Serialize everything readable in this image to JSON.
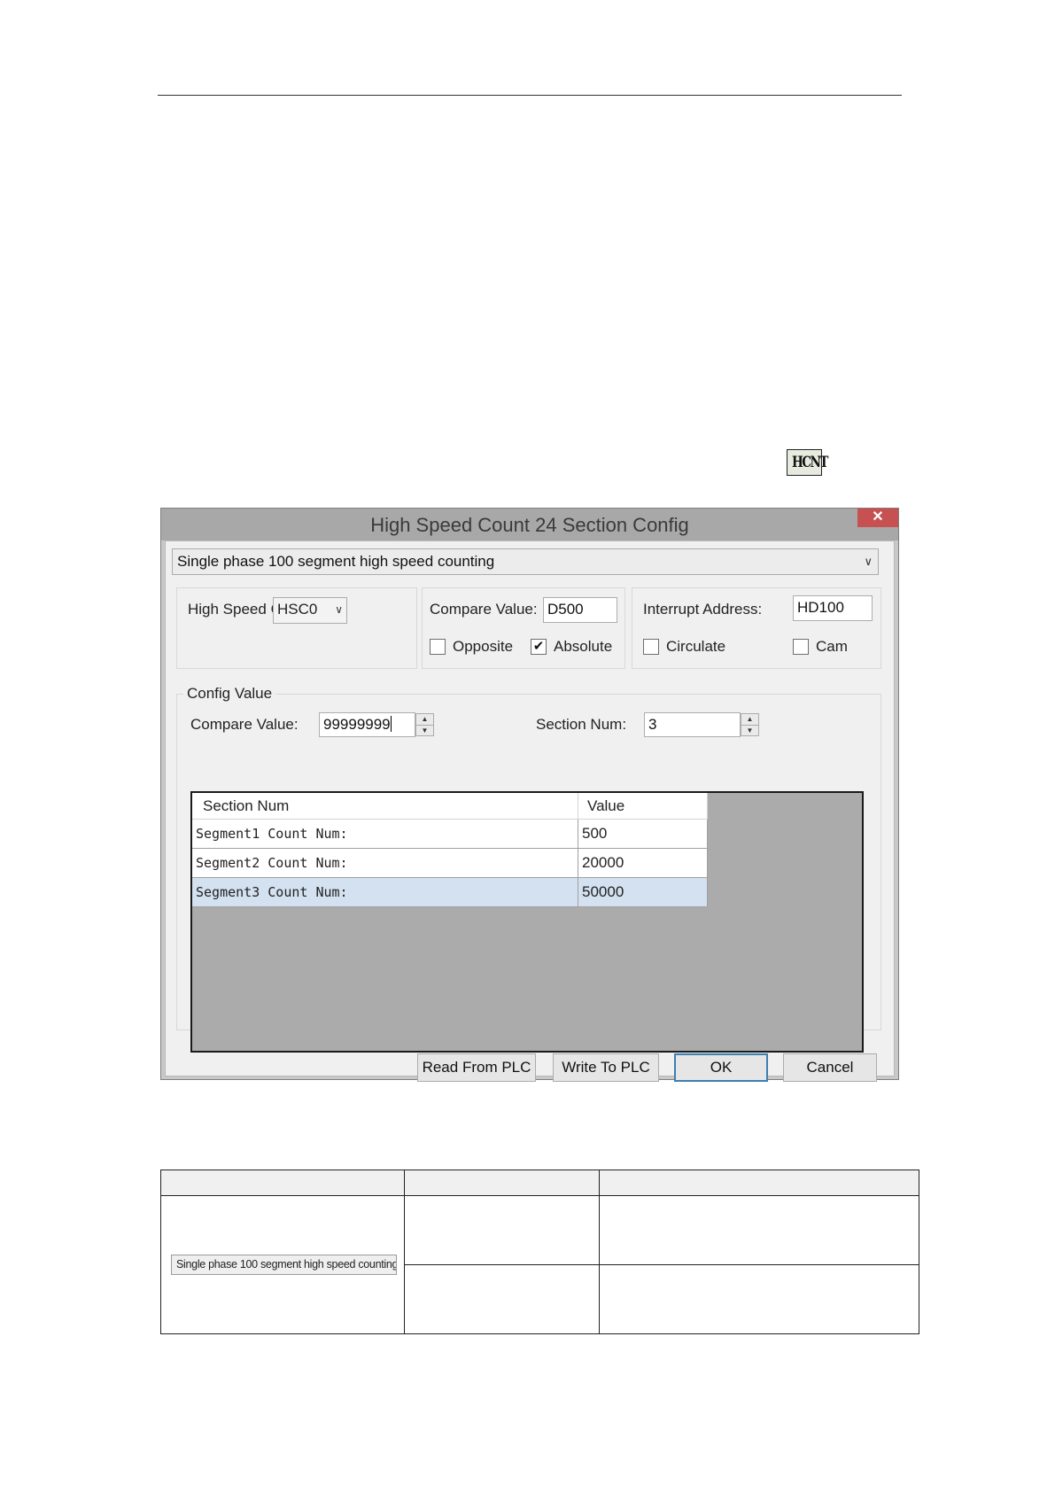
{
  "toolbar_icon": {
    "label": "HCNT",
    "name": "hcnt-icon"
  },
  "dialog": {
    "title": "High Speed Count 24 Section Config",
    "close_glyph": "✕",
    "mode_select": {
      "value": "Single phase 100 segment high speed counting"
    },
    "high_speed_counter": {
      "label": "High Speed C",
      "value": "HSC0"
    },
    "compare": {
      "label": "Compare Value:",
      "value": "D500",
      "opposite_label": "Opposite",
      "opposite_checked": false,
      "absolute_label": "Absolute",
      "absolute_checked": true
    },
    "interrupt": {
      "label": "Interrupt Address:",
      "value": "HD100",
      "circulate_label": "Circulate",
      "circulate_checked": false,
      "cam_label": "Cam",
      "cam_checked": false
    },
    "config_value": {
      "group_label": "Config Value",
      "compare_label": "Compare Value:",
      "compare_value": "99999999",
      "section_label": "Section Num:",
      "section_value": "3"
    },
    "grid": {
      "headers": [
        "Section Num",
        "Value"
      ],
      "rows": [
        {
          "name": "Segment1 Count Num:",
          "value": "500"
        },
        {
          "name": "Segment2 Count Num:",
          "value": "20000"
        },
        {
          "name": "Segment3 Count Num:",
          "value": "50000"
        }
      ],
      "selected_row": 2
    },
    "buttons": {
      "read": "Read From PLC",
      "write": "Write To PLC",
      "ok": "OK",
      "cancel": "Cancel"
    }
  },
  "bottom_table": {
    "mode_thumbnail": "Single phase 100 segment high speed counting"
  },
  "colors": {
    "titlebar": "#a8a8a8",
    "close": "#c75050",
    "selected_row": "#d3e1f0",
    "grid_bg": "#ababab",
    "default_button_border": "#3c7fb1"
  }
}
